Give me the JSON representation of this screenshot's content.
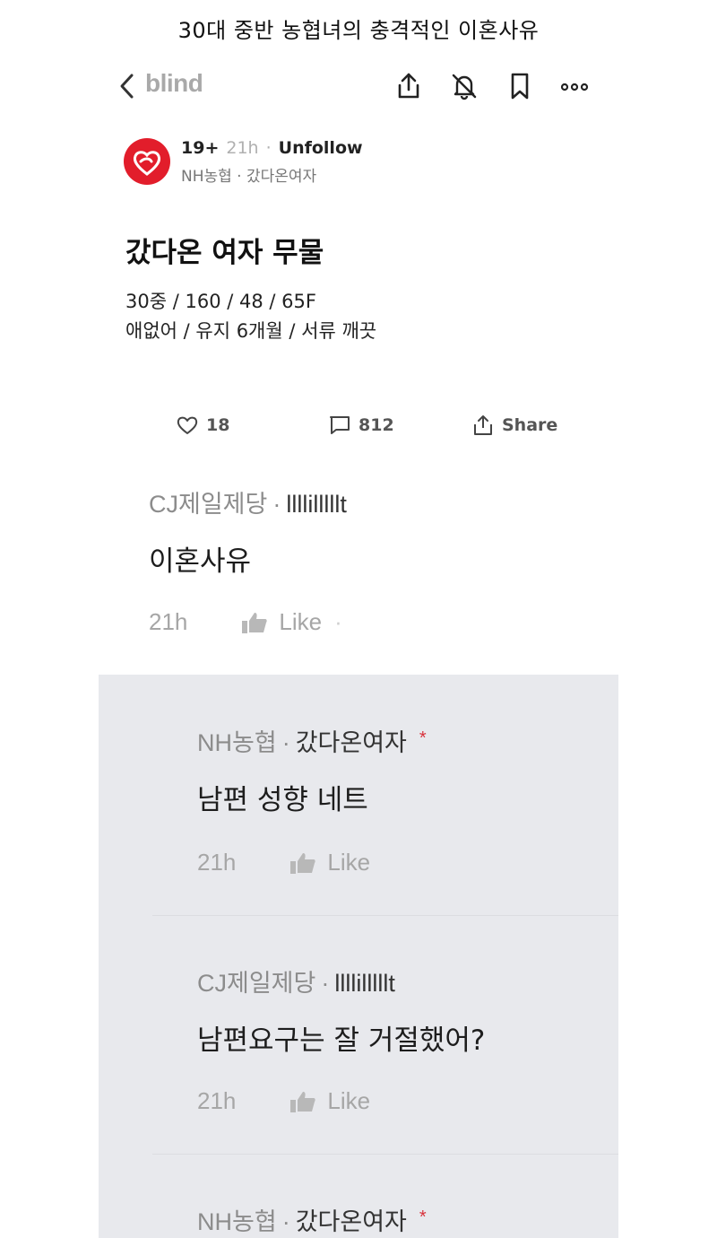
{
  "caption": "30대 중반 농협녀의 충격적인 이혼사유",
  "nav": {
    "brand": "blind",
    "icons": [
      "back-chevron-icon",
      "share-icon",
      "notification-off-icon",
      "bookmark-icon",
      "more-icon"
    ]
  },
  "author": {
    "level": "19+",
    "time": "21h",
    "dot": "·",
    "follow_label": "Unfollow",
    "company_line": "NH농협 · 갔다온여자"
  },
  "post": {
    "title": "갔다온 여자 무물",
    "lines": [
      "30중 / 160 / 48 / 65F",
      "애없어 / 유지 6개월 / 서류 깨끗"
    ]
  },
  "actions": {
    "likes": "18",
    "comments": "812",
    "share": "Share"
  },
  "comments": [
    {
      "company": "CJ제일제당",
      "dot": "·",
      "nickname": "llllilllllt",
      "op": "",
      "text": "이혼사유",
      "time": "21h",
      "like": "Like",
      "trail": "·"
    },
    {
      "company": "NH농협",
      "dot": "·",
      "nickname": "갔다온여자",
      "op": "*",
      "text": "남편 성향 네트",
      "time": "21h",
      "like": "Like",
      "trail": ""
    },
    {
      "company": "CJ제일제당",
      "dot": "·",
      "nickname": "llllilllllt",
      "op": "",
      "text": "남편요구는 잘 거절했어?",
      "time": "21h",
      "like": "Like",
      "trail": ""
    },
    {
      "company": "NH농협",
      "dot": "·",
      "nickname": "갔다온여자",
      "op": "*",
      "text": "",
      "time": "",
      "like": "",
      "trail": ""
    }
  ],
  "colors": {
    "brand_gray": "#a9a9a9",
    "avatar_red": "#e21d2b",
    "op_star": "#d8323c",
    "reply_bg": "#e8e9ed"
  }
}
